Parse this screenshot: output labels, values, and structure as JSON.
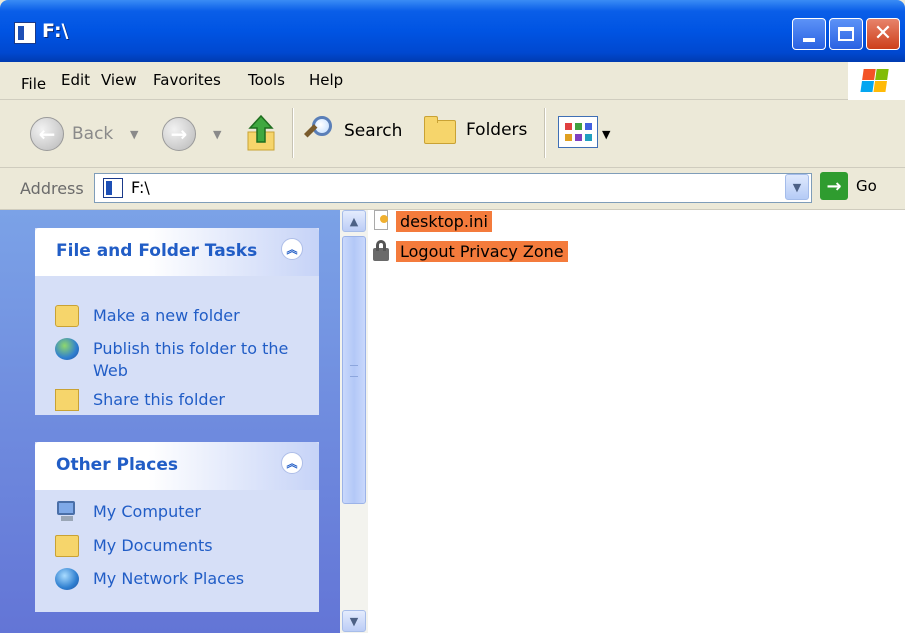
{
  "window": {
    "title": "F:\\",
    "minimize_label": "",
    "maximize_label": "",
    "close_glyph": "✕"
  },
  "menu": {
    "items": [
      "File",
      "Edit",
      "View",
      "Favorites",
      "Tools",
      "Help"
    ]
  },
  "toolbar": {
    "back_label": "Back",
    "back_arrow": "←",
    "forward_arrow": "→",
    "dropdown_glyph": "▼",
    "search_label": "Search",
    "folders_label": "Folders"
  },
  "address": {
    "label": "Address",
    "value": "F:\\",
    "dropdown_glyph": "▼",
    "go_arrow": "→",
    "go_label": "Go"
  },
  "task_pane": {
    "collapse_glyph": "︽",
    "file_tasks": {
      "title": "File and Folder Tasks",
      "items": [
        {
          "label": "Make a new folder",
          "icon": "new-folder-icon"
        },
        {
          "label": "Publish this folder to the Web",
          "icon": "globe-icon"
        },
        {
          "label": "Share this folder",
          "icon": "share-folder-icon"
        }
      ]
    },
    "other_places": {
      "title": "Other Places",
      "items": [
        {
          "label": "My Computer",
          "icon": "computer-icon"
        },
        {
          "label": "My Documents",
          "icon": "documents-icon"
        },
        {
          "label": "My Network Places",
          "icon": "network-icon"
        }
      ]
    }
  },
  "scrollbar": {
    "up_glyph": "▲",
    "down_glyph": "▼"
  },
  "files": [
    {
      "name": "desktop.ini",
      "icon": "ini-file-icon"
    },
    {
      "name": "Logout Privacy Zone",
      "icon": "lock-icon"
    }
  ],
  "colors": {
    "selection": "#F47B3C",
    "task_link": "#215DC6",
    "titlebar": "#0054E3"
  }
}
